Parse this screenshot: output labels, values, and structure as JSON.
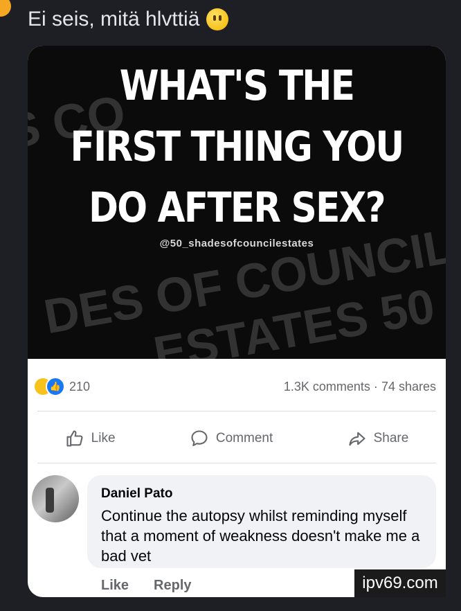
{
  "caption": {
    "text": "Ei seis, mitä hlvttiä",
    "emoji": "neutral-face-emoji"
  },
  "meme": {
    "headline_lines": [
      "WHAT'S THE",
      "FIRST THING YOU",
      "DO AFTER SEX?"
    ],
    "handle": "@50_shadesofcouncilestates"
  },
  "post_stats": {
    "reactions": [
      "haha",
      "like"
    ],
    "reaction_count": "210",
    "comments": "1.3K comments",
    "separator": "·",
    "shares": "74 shares"
  },
  "actions": {
    "like": "Like",
    "comment": "Comment",
    "share": "Share"
  },
  "comment": {
    "author": "Daniel Pato",
    "text": "Continue the autopsy whilst reminding myself that a moment of weakness doesn't make me a bad vet",
    "like_label": "Like",
    "reply_label": "Reply"
  },
  "watermark": "ipv69.com",
  "colors": {
    "page_bg": "#1e1f24",
    "card_bg": "#ffffff",
    "bubble_bg": "#f0f2f5",
    "secondary_text": "#65676b",
    "like_blue": "#1877f2"
  }
}
